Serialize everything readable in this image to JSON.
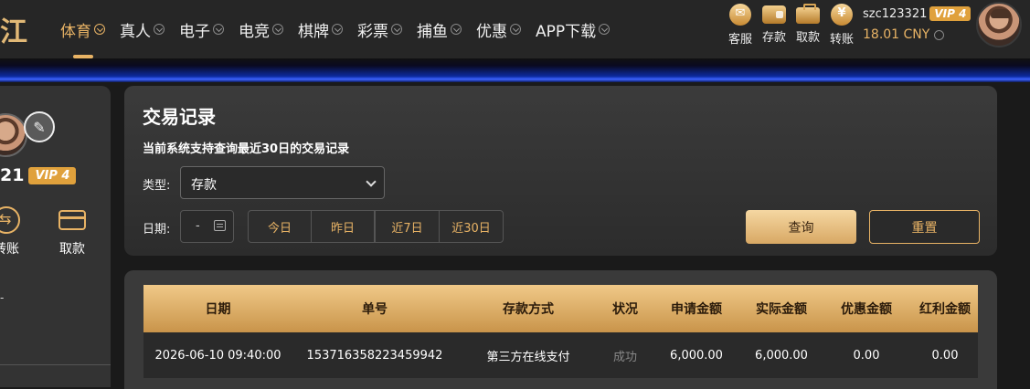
{
  "logo": {
    "text": "江"
  },
  "nav": {
    "items": [
      {
        "label": "体育",
        "active": true
      },
      {
        "label": "真人"
      },
      {
        "label": "电子"
      },
      {
        "label": "电竞"
      },
      {
        "label": "棋牌"
      },
      {
        "label": "彩票"
      },
      {
        "label": "捕鱼"
      },
      {
        "label": "优惠"
      },
      {
        "label": "APP下载"
      }
    ]
  },
  "header": {
    "quick": [
      {
        "label": "客服",
        "icon": "service-icon"
      },
      {
        "label": "存款",
        "icon": "wallet-icon"
      },
      {
        "label": "取款",
        "icon": "briefcase-icon"
      },
      {
        "label": "转账",
        "icon": "coin-icon"
      }
    ],
    "username": "szc123321",
    "vip": "VIP 4",
    "balance": "18.01 CNY"
  },
  "sidebar": {
    "username": "21",
    "vip": "VIP 4",
    "actions": [
      {
        "label": "转账"
      },
      {
        "label": "取款"
      }
    ],
    "dot": "-"
  },
  "panel": {
    "title": "交易记录",
    "subtitle": "当前系统支持查询最近30日的交易记录",
    "type_label": "类型:",
    "type_value": "存款",
    "date_label": "日期:",
    "date_value": "-",
    "ranges": [
      "今日",
      "昨日",
      "近7日",
      "近30日"
    ],
    "query": "查询",
    "reset": "重置"
  },
  "table": {
    "headers": [
      "日期",
      "单号",
      "存款方式",
      "状况",
      "申请金额",
      "实际金额",
      "优惠金额",
      "红利金额"
    ],
    "rows": [
      [
        "2026-06-10 09:40:00",
        "153716358223459942",
        "第三方在线支付",
        "成功",
        "6,000.00",
        "6,000.00",
        "0.00",
        "0.00"
      ]
    ]
  },
  "colors": {
    "accent": "#e8b365",
    "background": "#1a1a1a",
    "panel": "#333333"
  }
}
